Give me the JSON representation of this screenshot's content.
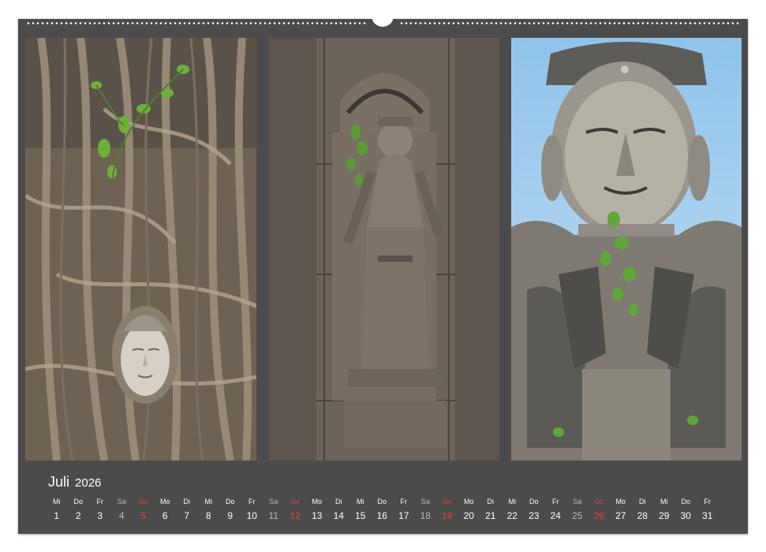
{
  "calendar": {
    "month": "Juli",
    "year": "2026",
    "colors": {
      "weekday": "#ffffff",
      "saturday": "#b9b9b9",
      "sunday": "#e0403a",
      "background": "#4b4b4b"
    },
    "days": [
      {
        "wd": "Mi",
        "n": "1"
      },
      {
        "wd": "Do",
        "n": "2"
      },
      {
        "wd": "Fr",
        "n": "3"
      },
      {
        "wd": "Sa",
        "n": "4"
      },
      {
        "wd": "So",
        "n": "5"
      },
      {
        "wd": "Mo",
        "n": "6"
      },
      {
        "wd": "Di",
        "n": "7"
      },
      {
        "wd": "Mi",
        "n": "8"
      },
      {
        "wd": "Do",
        "n": "9"
      },
      {
        "wd": "Fr",
        "n": "10"
      },
      {
        "wd": "Sa",
        "n": "11"
      },
      {
        "wd": "So",
        "n": "12"
      },
      {
        "wd": "Mo",
        "n": "13"
      },
      {
        "wd": "Di",
        "n": "14"
      },
      {
        "wd": "Mi",
        "n": "15"
      },
      {
        "wd": "Do",
        "n": "16"
      },
      {
        "wd": "Fr",
        "n": "17"
      },
      {
        "wd": "Sa",
        "n": "18"
      },
      {
        "wd": "So",
        "n": "19"
      },
      {
        "wd": "Mo",
        "n": "20"
      },
      {
        "wd": "Di",
        "n": "21"
      },
      {
        "wd": "Mi",
        "n": "22"
      },
      {
        "wd": "Do",
        "n": "23"
      },
      {
        "wd": "Fr",
        "n": "24"
      },
      {
        "wd": "Sa",
        "n": "25"
      },
      {
        "wd": "So",
        "n": "26"
      },
      {
        "wd": "Mo",
        "n": "27"
      },
      {
        "wd": "Di",
        "n": "28"
      },
      {
        "wd": "Mi",
        "n": "29"
      },
      {
        "wd": "Do",
        "n": "30"
      },
      {
        "wd": "Fr",
        "n": "31"
      }
    ]
  },
  "photos": [
    {
      "subject": "buddha-head-in-tree-roots"
    },
    {
      "subject": "stone-relief-devata"
    },
    {
      "subject": "buddha-statue-with-plant"
    }
  ]
}
